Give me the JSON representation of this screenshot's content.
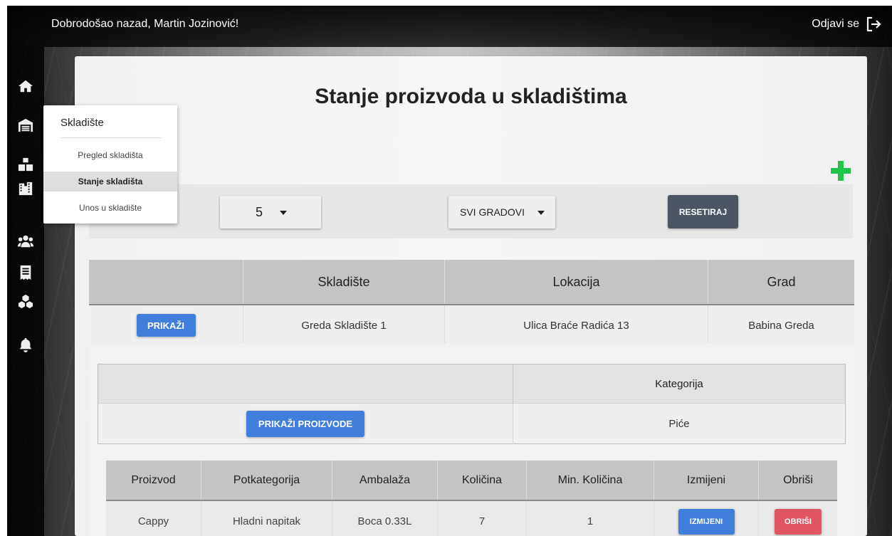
{
  "header": {
    "welcome": "Dobrodošao nazad, Martin Jozinović!",
    "logout_label": "Odjavi se"
  },
  "sidebar": {
    "items": [
      {
        "icon": "home-icon"
      },
      {
        "icon": "warehouse-icon"
      },
      {
        "icon": "boxes-icon"
      },
      {
        "icon": "city-icon"
      },
      {
        "icon": "users-icon"
      },
      {
        "icon": "receipt-icon"
      },
      {
        "icon": "cubes-icon"
      },
      {
        "icon": "bell-icon"
      }
    ]
  },
  "menu": {
    "title": "Skladište",
    "items": [
      {
        "label": "Pregled skladišta"
      },
      {
        "label": "Stanje skladišta"
      },
      {
        "label": "Unos u skladište"
      }
    ]
  },
  "page": {
    "title": "Stanje proizvoda u skladištima"
  },
  "filters": {
    "page_size": "5",
    "city": "SVI GRADOVI",
    "reset_label": "RESETIRAJ"
  },
  "warehouses": {
    "columns": [
      "",
      "Skladište",
      "Lokacija",
      "Grad"
    ],
    "rows": [
      {
        "action": "PRIKAŽI",
        "name": "Greda Skladište 1",
        "location": "Ulica Braće Radića 13",
        "city": "Babina Greda"
      }
    ]
  },
  "categories": {
    "columns": [
      "",
      "Kategorija"
    ],
    "rows": [
      {
        "action": "PRIKAŽI PROIZVODE",
        "category": "Piće"
      }
    ]
  },
  "products": {
    "columns": [
      "Proizvod",
      "Potkategorija",
      "Ambalaža",
      "Količina",
      "Min. Količina",
      "Izmijeni",
      "Obriši"
    ],
    "rows": [
      {
        "product": "Cappy",
        "subcategory": "Hladni napitak",
        "packaging": "Boca 0.33L",
        "quantity": "7",
        "min_quantity": "1",
        "edit_label": "IZMIJENI",
        "delete_label": "OBRIŠI"
      }
    ]
  },
  "colors": {
    "primary": "#3f7fdb",
    "danger": "#e05563",
    "dark": "#4b5563",
    "add": "#22c34b"
  }
}
